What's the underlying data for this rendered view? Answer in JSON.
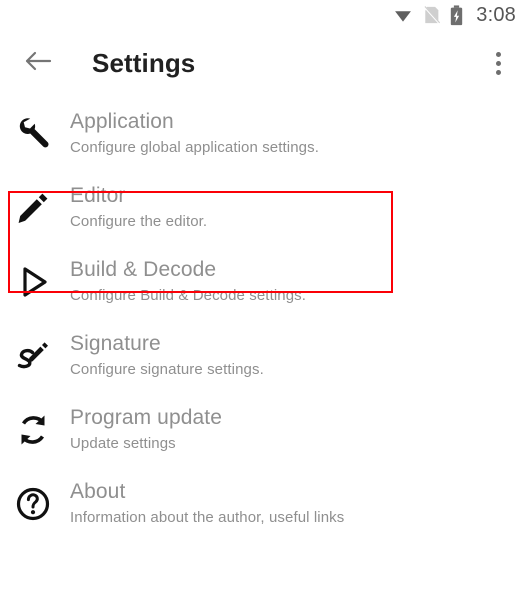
{
  "status_bar": {
    "wifi_icon": "wifi-icon",
    "sim_icon": "no-sim-card-icon",
    "battery_icon": "battery-charging-icon",
    "time": "3:08"
  },
  "app_bar": {
    "back_icon": "back-arrow-icon",
    "title": "Settings",
    "overflow_icon": "overflow-menu-icon"
  },
  "settings": {
    "items": [
      {
        "icon": "wrench-icon",
        "title": "Application",
        "subtitle": "Configure global application settings."
      },
      {
        "icon": "pencil-icon",
        "title": "Editor",
        "subtitle": "Configure the editor."
      },
      {
        "icon": "play-triangle-icon",
        "title": "Build & Decode",
        "subtitle": "Configure Build & Decode settings."
      },
      {
        "icon": "signature-pen-icon",
        "title": "Signature",
        "subtitle": "Configure signature settings."
      },
      {
        "icon": "refresh-sync-icon",
        "title": "Program update",
        "subtitle": "Update settings"
      },
      {
        "icon": "question-circle-icon",
        "title": "About",
        "subtitle": "Information about the author, useful links"
      }
    ]
  },
  "annotation": {
    "highlight_color": "#fb0007",
    "target": "Application"
  },
  "colors": {
    "background": "#ffffff",
    "title_text": "#212121",
    "row_text": "#8f8f8f",
    "icon": "#000000",
    "status_icon": "#6e6e6e"
  }
}
